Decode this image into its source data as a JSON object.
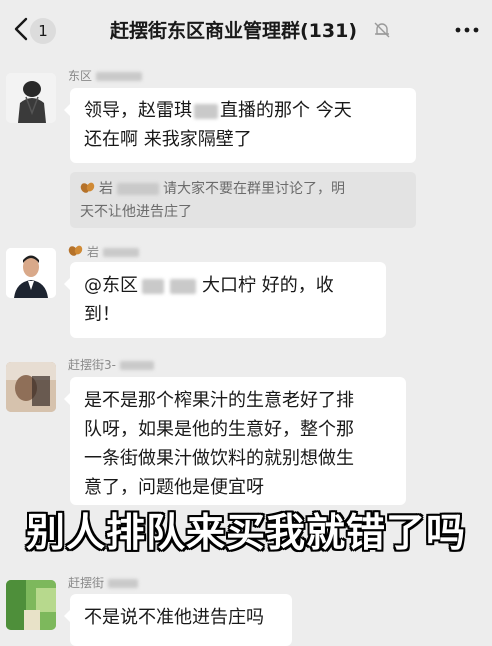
{
  "header": {
    "back_count": "1",
    "title": "赶摆街东区商业管理群(131)",
    "back_icon": "chevron-left-icon",
    "mute_icon": "bell-muted-icon",
    "more_icon": "more-dots-icon"
  },
  "messages": [
    {
      "sender": "东区",
      "text_lines": [
        "领导，赵雷琪",
        "直播的那个 今天",
        "还在啊  来我家隔壁了"
      ],
      "quote": {
        "sender": "岩",
        "text_line1": "请大家不要在群里讨论了，明",
        "text_line2": "天不让他进告庄了"
      }
    },
    {
      "sender": "岩",
      "text_line1_a": "@东区",
      "text_line1_b": "大口柠 好的，收",
      "text_line2": "到！"
    },
    {
      "sender": "赶摆街3-",
      "text_lines": [
        "是不是那个榨果汁的生意老好了排",
        "队呀，如果是他的生意好，整个那",
        "一条街做果汁做饮料的就别想做生",
        "意了，问题他是便宜呀"
      ]
    },
    {
      "sender": "赶摆街",
      "text": "不是说不准他进告庄吗"
    }
  ],
  "caption": "别人排队来买我就错了吗",
  "colors": {
    "background": "#ededed",
    "bubble": "#ffffff",
    "quote": "#e3e3e3",
    "meta_text": "#8a8a8a"
  }
}
